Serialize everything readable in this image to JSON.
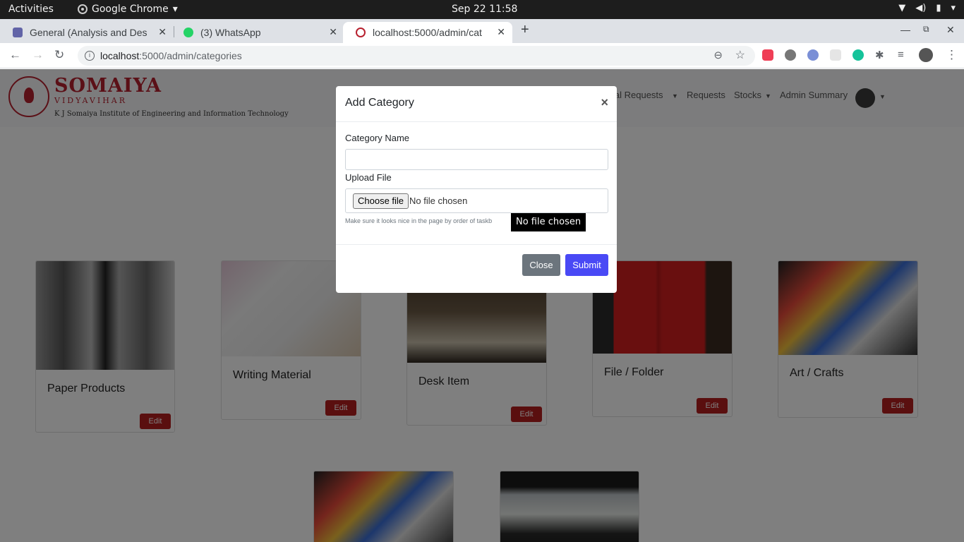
{
  "topbar": {
    "activities": "Activities",
    "app_name": "Google Chrome",
    "clock": "Sep 22  11:58"
  },
  "tabs": [
    {
      "title": "General (Analysis and Des",
      "icon_color": "#6264a7",
      "icon": "teams-icon"
    },
    {
      "title": "(3) WhatsApp",
      "icon_color": "#25d366",
      "icon": "whatsapp-icon"
    },
    {
      "title": "localhost:5000/admin/cat",
      "icon_color": "#b7202e",
      "icon": "somaiya-favicon"
    }
  ],
  "omnibox": {
    "host": "localhost",
    "path": ":5000/admin/categories"
  },
  "site": {
    "logo_main": "SOMAIYA",
    "logo_sub": "VIDYAVIHAR",
    "logo_inst": "K J Somaiya Institute of Engineering and Information Technology",
    "nav": {
      "special_requests": "ial Requests",
      "requests": "Requests",
      "stocks": "Stocks",
      "admin_summary": "Admin Summary"
    }
  },
  "categories": [
    {
      "name": "Paper Products",
      "edit": "Edit"
    },
    {
      "name": "Writing Material",
      "edit": "Edit"
    },
    {
      "name": "Desk Item",
      "edit": "Edit"
    },
    {
      "name": "File / Folder",
      "edit": "Edit"
    },
    {
      "name": "Art / Crafts",
      "edit": "Edit"
    }
  ],
  "modal": {
    "title": "Add Category",
    "close_x": "×",
    "category_name_label": "Category Name",
    "category_name_value": "",
    "upload_label": "Upload File",
    "choose_file": "Choose file",
    "file_status": "No file chosen",
    "help_text": "Make sure it looks nice in the page by order of taskb",
    "close_button": "Close",
    "submit_button": "Submit"
  },
  "tooltip": "No file chosen"
}
